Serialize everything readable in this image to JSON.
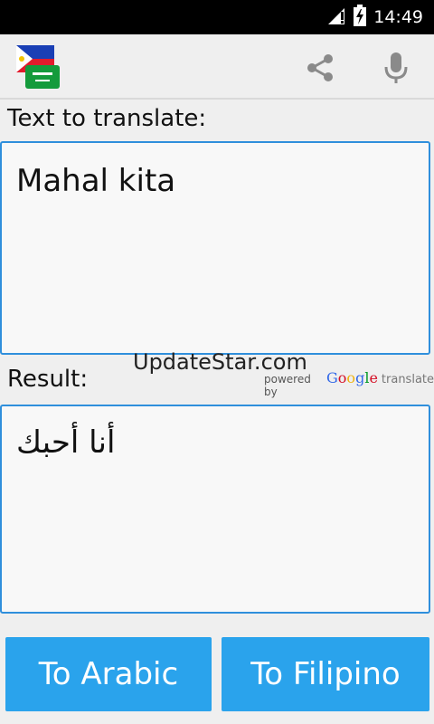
{
  "status": {
    "time": "14:49"
  },
  "labels": {
    "text_to_translate": "Text to translate:",
    "result": "Result:"
  },
  "input": {
    "value": "Mahal kita"
  },
  "output": {
    "value": "أنا أحبك"
  },
  "watermark": "UpdateStar.com",
  "powered_by": {
    "prefix": "powered by",
    "brand_letters": [
      "G",
      "o",
      "o",
      "g",
      "l",
      "e"
    ],
    "suffix": "translate"
  },
  "buttons": {
    "to_arabic": "To Arabic",
    "to_filipino": "To Filipino"
  },
  "colors": {
    "accent_border": "#2f8fdc",
    "button_bg": "#2aa3ec",
    "background": "#efefef"
  },
  "icons": [
    "signal-icon",
    "battery-charging-icon",
    "language-flags-icon",
    "share-icon",
    "microphone-icon"
  ]
}
